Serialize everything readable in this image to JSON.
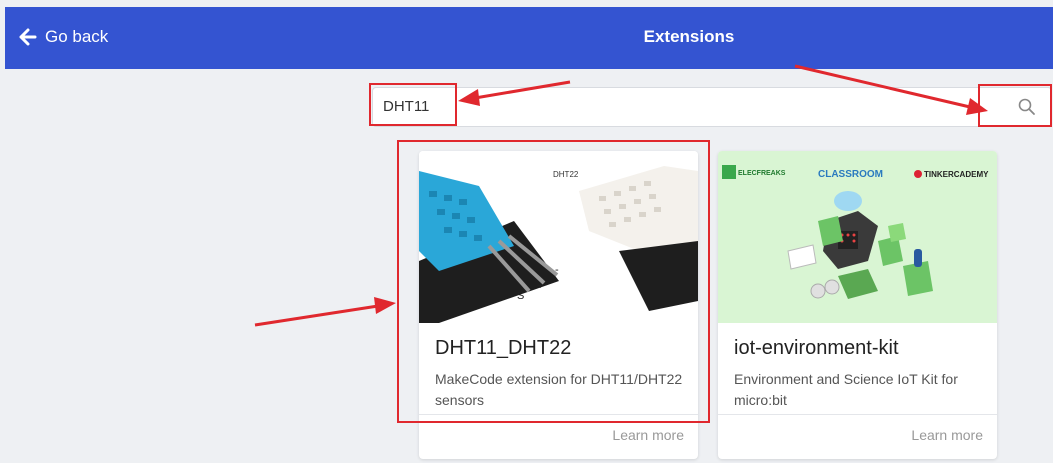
{
  "header": {
    "back_label": "Go back",
    "title": "Extensions"
  },
  "search": {
    "value": "DHT11",
    "icon": "search-icon"
  },
  "cards": [
    {
      "title": "DHT11_DHT22",
      "description": "MakeCode extension for DHT11/DHT22 sensors",
      "image_label": "DHT22",
      "image_pin_labels": [
        "S",
        "+",
        "-"
      ],
      "learn_more": "Learn more"
    },
    {
      "title": "iot-environment-kit",
      "description": "Environment and Science IoT Kit for micro:bit",
      "logos": [
        "ELECFREAKS",
        "CLASSROOM",
        "TINKERCADEMY"
      ],
      "learn_more": "Learn more"
    }
  ],
  "colors": {
    "header_bg": "#3454d1",
    "annotation": "#e0282e",
    "card2_bg": "#d9f5d3"
  }
}
